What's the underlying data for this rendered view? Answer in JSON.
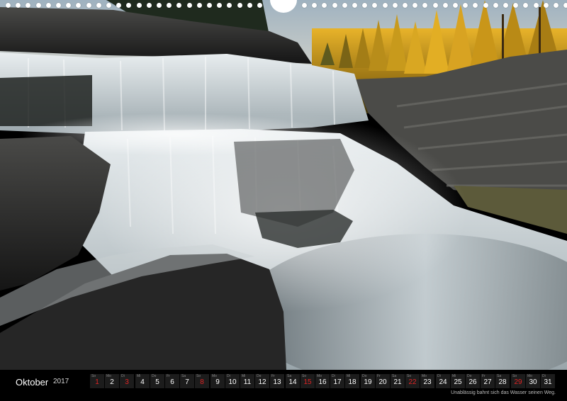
{
  "calendar": {
    "month": "Oktober",
    "year": "2017",
    "caption": "Unablässig bahnt sich das Wasser seinen Weg.",
    "days": [
      {
        "wd": "So",
        "d": "1",
        "red": true
      },
      {
        "wd": "Mo",
        "d": "2",
        "red": false
      },
      {
        "wd": "Di",
        "d": "3",
        "red": true
      },
      {
        "wd": "Mi",
        "d": "4",
        "red": false
      },
      {
        "wd": "Do",
        "d": "5",
        "red": false
      },
      {
        "wd": "Fr",
        "d": "6",
        "red": false
      },
      {
        "wd": "Sa",
        "d": "7",
        "red": false
      },
      {
        "wd": "So",
        "d": "8",
        "red": true
      },
      {
        "wd": "Mo",
        "d": "9",
        "red": false
      },
      {
        "wd": "Di",
        "d": "10",
        "red": false
      },
      {
        "wd": "Mi",
        "d": "11",
        "red": false
      },
      {
        "wd": "Do",
        "d": "12",
        "red": false
      },
      {
        "wd": "Fr",
        "d": "13",
        "red": false
      },
      {
        "wd": "Sa",
        "d": "14",
        "red": false
      },
      {
        "wd": "So",
        "d": "15",
        "red": true
      },
      {
        "wd": "Mo",
        "d": "16",
        "red": false
      },
      {
        "wd": "Di",
        "d": "17",
        "red": false
      },
      {
        "wd": "Mi",
        "d": "18",
        "red": false
      },
      {
        "wd": "Do",
        "d": "19",
        "red": false
      },
      {
        "wd": "Fr",
        "d": "20",
        "red": false
      },
      {
        "wd": "Sa",
        "d": "21",
        "red": false
      },
      {
        "wd": "So",
        "d": "22",
        "red": true
      },
      {
        "wd": "Mo",
        "d": "23",
        "red": false
      },
      {
        "wd": "Di",
        "d": "24",
        "red": false
      },
      {
        "wd": "Mi",
        "d": "25",
        "red": false
      },
      {
        "wd": "Do",
        "d": "26",
        "red": false
      },
      {
        "wd": "Fr",
        "d": "27",
        "red": false
      },
      {
        "wd": "Sa",
        "d": "28",
        "red": false
      },
      {
        "wd": "So",
        "d": "29",
        "red": true
      },
      {
        "wd": "Mo",
        "d": "30",
        "red": false
      },
      {
        "wd": "Di",
        "d": "31",
        "red": false
      }
    ]
  },
  "colors": {
    "sunday_red": "#e02424",
    "forest_gold": "#c89a1c",
    "sky": "#c9d6dc",
    "water": "#d7dde0",
    "rock": "#2a2a2a"
  }
}
